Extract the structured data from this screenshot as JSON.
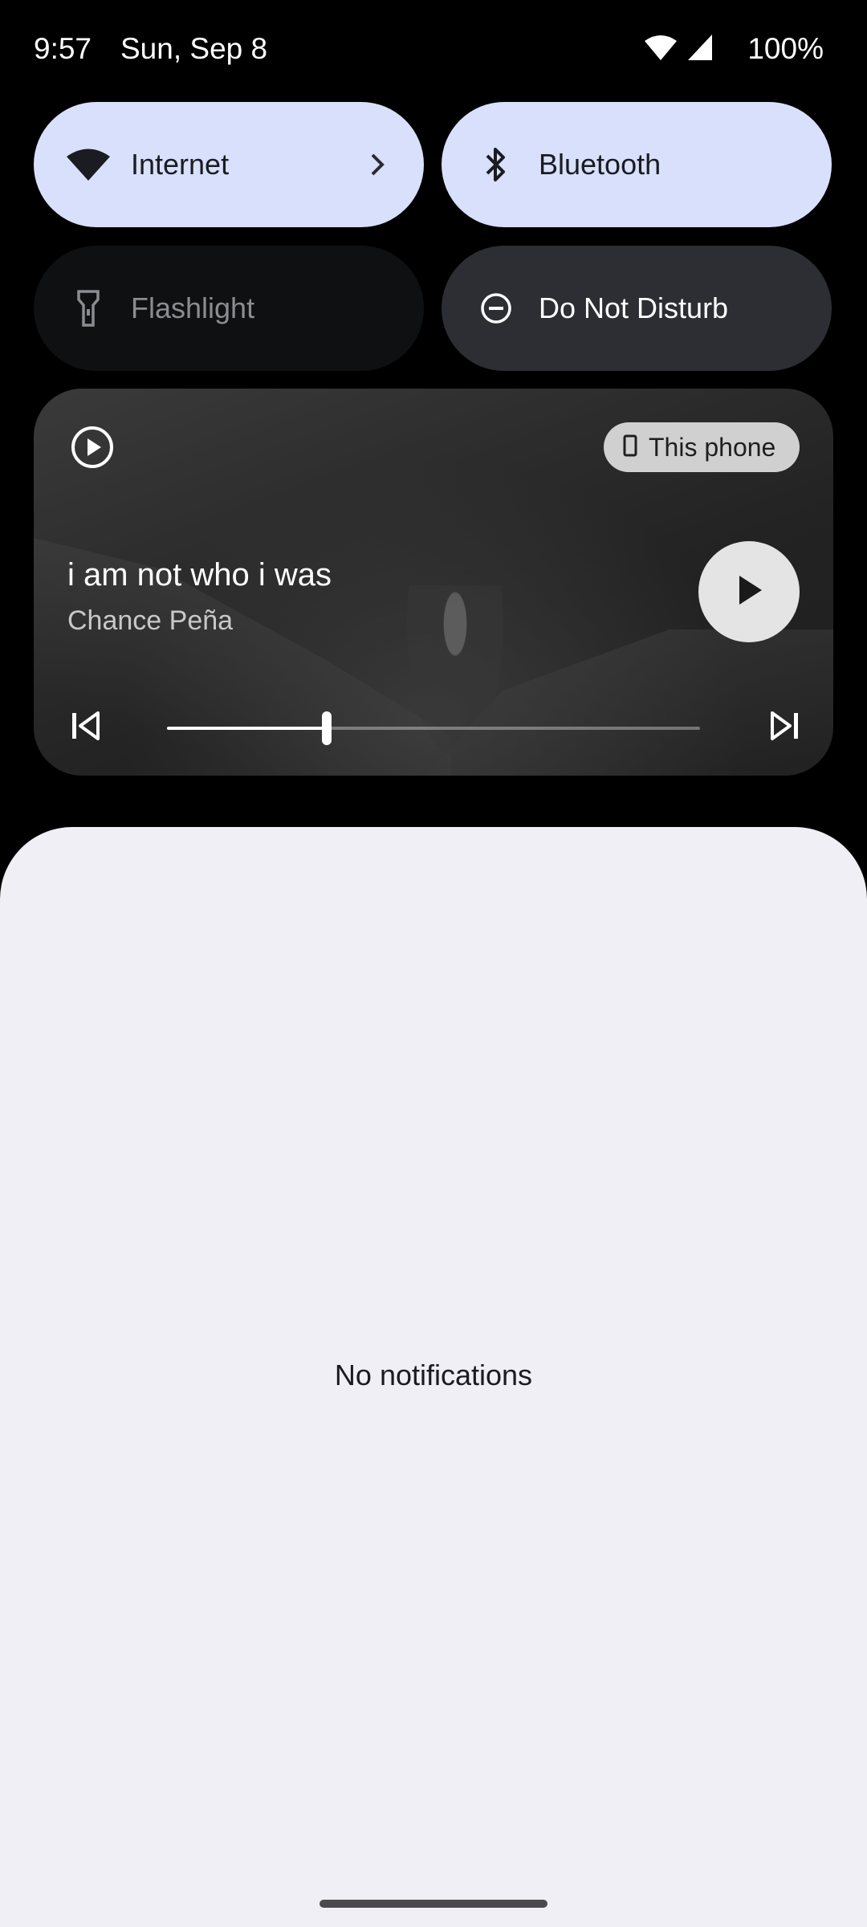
{
  "status_bar": {
    "time": "9:57",
    "date": "Sun, Sep 8",
    "battery": "100%"
  },
  "quick_settings": {
    "tiles": [
      {
        "label": "Internet",
        "icon": "wifi-icon",
        "state": "on"
      },
      {
        "label": "Bluetooth",
        "icon": "bluetooth-icon",
        "state": "on"
      },
      {
        "label": "Flashlight",
        "icon": "flashlight-icon",
        "state": "unavailable"
      },
      {
        "label": "Do Not Disturb",
        "icon": "do-not-disturb-icon",
        "state": "off"
      }
    ]
  },
  "media": {
    "output_device": "This phone",
    "title": "i am not who i was",
    "artist": "Chance Peña",
    "progress": 0.3
  },
  "notifications": {
    "empty_text": "No notifications"
  },
  "colors": {
    "tile_active": "#d9e0fb",
    "tile_inactive": "#2d2e33",
    "panel_bg": "#efeff5"
  }
}
